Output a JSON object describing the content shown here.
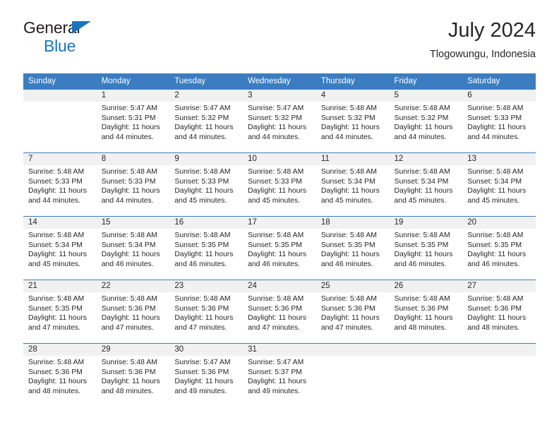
{
  "brand": {
    "line1": "General",
    "line2": "Blue",
    "triangle_color": "#1b74bb"
  },
  "header": {
    "title": "July 2024",
    "location": "Tlogowungu, Indonesia"
  },
  "theme": {
    "header_blue": "#3b7dc0",
    "daynum_background": "#f1f1f1",
    "text": "#262626"
  },
  "weekday_headers": [
    "Sunday",
    "Monday",
    "Tuesday",
    "Wednesday",
    "Thursday",
    "Friday",
    "Saturday"
  ],
  "weeks": [
    [
      {
        "day": "",
        "sunrise": "",
        "sunset": "",
        "daylight_line1": "",
        "daylight_line2": ""
      },
      {
        "day": "1",
        "sunrise": "Sunrise: 5:47 AM",
        "sunset": "Sunset: 5:31 PM",
        "daylight_line1": "Daylight: 11 hours",
        "daylight_line2": "and 44 minutes."
      },
      {
        "day": "2",
        "sunrise": "Sunrise: 5:47 AM",
        "sunset": "Sunset: 5:32 PM",
        "daylight_line1": "Daylight: 11 hours",
        "daylight_line2": "and 44 minutes."
      },
      {
        "day": "3",
        "sunrise": "Sunrise: 5:47 AM",
        "sunset": "Sunset: 5:32 PM",
        "daylight_line1": "Daylight: 11 hours",
        "daylight_line2": "and 44 minutes."
      },
      {
        "day": "4",
        "sunrise": "Sunrise: 5:48 AM",
        "sunset": "Sunset: 5:32 PM",
        "daylight_line1": "Daylight: 11 hours",
        "daylight_line2": "and 44 minutes."
      },
      {
        "day": "5",
        "sunrise": "Sunrise: 5:48 AM",
        "sunset": "Sunset: 5:32 PM",
        "daylight_line1": "Daylight: 11 hours",
        "daylight_line2": "and 44 minutes."
      },
      {
        "day": "6",
        "sunrise": "Sunrise: 5:48 AM",
        "sunset": "Sunset: 5:33 PM",
        "daylight_line1": "Daylight: 11 hours",
        "daylight_line2": "and 44 minutes."
      }
    ],
    [
      {
        "day": "7",
        "sunrise": "Sunrise: 5:48 AM",
        "sunset": "Sunset: 5:33 PM",
        "daylight_line1": "Daylight: 11 hours",
        "daylight_line2": "and 44 minutes."
      },
      {
        "day": "8",
        "sunrise": "Sunrise: 5:48 AM",
        "sunset": "Sunset: 5:33 PM",
        "daylight_line1": "Daylight: 11 hours",
        "daylight_line2": "and 44 minutes."
      },
      {
        "day": "9",
        "sunrise": "Sunrise: 5:48 AM",
        "sunset": "Sunset: 5:33 PM",
        "daylight_line1": "Daylight: 11 hours",
        "daylight_line2": "and 45 minutes."
      },
      {
        "day": "10",
        "sunrise": "Sunrise: 5:48 AM",
        "sunset": "Sunset: 5:33 PM",
        "daylight_line1": "Daylight: 11 hours",
        "daylight_line2": "and 45 minutes."
      },
      {
        "day": "11",
        "sunrise": "Sunrise: 5:48 AM",
        "sunset": "Sunset: 5:34 PM",
        "daylight_line1": "Daylight: 11 hours",
        "daylight_line2": "and 45 minutes."
      },
      {
        "day": "12",
        "sunrise": "Sunrise: 5:48 AM",
        "sunset": "Sunset: 5:34 PM",
        "daylight_line1": "Daylight: 11 hours",
        "daylight_line2": "and 45 minutes."
      },
      {
        "day": "13",
        "sunrise": "Sunrise: 5:48 AM",
        "sunset": "Sunset: 5:34 PM",
        "daylight_line1": "Daylight: 11 hours",
        "daylight_line2": "and 45 minutes."
      }
    ],
    [
      {
        "day": "14",
        "sunrise": "Sunrise: 5:48 AM",
        "sunset": "Sunset: 5:34 PM",
        "daylight_line1": "Daylight: 11 hours",
        "daylight_line2": "and 45 minutes."
      },
      {
        "day": "15",
        "sunrise": "Sunrise: 5:48 AM",
        "sunset": "Sunset: 5:34 PM",
        "daylight_line1": "Daylight: 11 hours",
        "daylight_line2": "and 46 minutes."
      },
      {
        "day": "16",
        "sunrise": "Sunrise: 5:48 AM",
        "sunset": "Sunset: 5:35 PM",
        "daylight_line1": "Daylight: 11 hours",
        "daylight_line2": "and 46 minutes."
      },
      {
        "day": "17",
        "sunrise": "Sunrise: 5:48 AM",
        "sunset": "Sunset: 5:35 PM",
        "daylight_line1": "Daylight: 11 hours",
        "daylight_line2": "and 46 minutes."
      },
      {
        "day": "18",
        "sunrise": "Sunrise: 5:48 AM",
        "sunset": "Sunset: 5:35 PM",
        "daylight_line1": "Daylight: 11 hours",
        "daylight_line2": "and 46 minutes."
      },
      {
        "day": "19",
        "sunrise": "Sunrise: 5:48 AM",
        "sunset": "Sunset: 5:35 PM",
        "daylight_line1": "Daylight: 11 hours",
        "daylight_line2": "and 46 minutes."
      },
      {
        "day": "20",
        "sunrise": "Sunrise: 5:48 AM",
        "sunset": "Sunset: 5:35 PM",
        "daylight_line1": "Daylight: 11 hours",
        "daylight_line2": "and 46 minutes."
      }
    ],
    [
      {
        "day": "21",
        "sunrise": "Sunrise: 5:48 AM",
        "sunset": "Sunset: 5:35 PM",
        "daylight_line1": "Daylight: 11 hours",
        "daylight_line2": "and 47 minutes."
      },
      {
        "day": "22",
        "sunrise": "Sunrise: 5:48 AM",
        "sunset": "Sunset: 5:36 PM",
        "daylight_line1": "Daylight: 11 hours",
        "daylight_line2": "and 47 minutes."
      },
      {
        "day": "23",
        "sunrise": "Sunrise: 5:48 AM",
        "sunset": "Sunset: 5:36 PM",
        "daylight_line1": "Daylight: 11 hours",
        "daylight_line2": "and 47 minutes."
      },
      {
        "day": "24",
        "sunrise": "Sunrise: 5:48 AM",
        "sunset": "Sunset: 5:36 PM",
        "daylight_line1": "Daylight: 11 hours",
        "daylight_line2": "and 47 minutes."
      },
      {
        "day": "25",
        "sunrise": "Sunrise: 5:48 AM",
        "sunset": "Sunset: 5:36 PM",
        "daylight_line1": "Daylight: 11 hours",
        "daylight_line2": "and 47 minutes."
      },
      {
        "day": "26",
        "sunrise": "Sunrise: 5:48 AM",
        "sunset": "Sunset: 5:36 PM",
        "daylight_line1": "Daylight: 11 hours",
        "daylight_line2": "and 48 minutes."
      },
      {
        "day": "27",
        "sunrise": "Sunrise: 5:48 AM",
        "sunset": "Sunset: 5:36 PM",
        "daylight_line1": "Daylight: 11 hours",
        "daylight_line2": "and 48 minutes."
      }
    ],
    [
      {
        "day": "28",
        "sunrise": "Sunrise: 5:48 AM",
        "sunset": "Sunset: 5:36 PM",
        "daylight_line1": "Daylight: 11 hours",
        "daylight_line2": "and 48 minutes."
      },
      {
        "day": "29",
        "sunrise": "Sunrise: 5:48 AM",
        "sunset": "Sunset: 5:36 PM",
        "daylight_line1": "Daylight: 11 hours",
        "daylight_line2": "and 48 minutes."
      },
      {
        "day": "30",
        "sunrise": "Sunrise: 5:47 AM",
        "sunset": "Sunset: 5:36 PM",
        "daylight_line1": "Daylight: 11 hours",
        "daylight_line2": "and 49 minutes."
      },
      {
        "day": "31",
        "sunrise": "Sunrise: 5:47 AM",
        "sunset": "Sunset: 5:37 PM",
        "daylight_line1": "Daylight: 11 hours",
        "daylight_line2": "and 49 minutes."
      },
      {
        "day": "",
        "sunrise": "",
        "sunset": "",
        "daylight_line1": "",
        "daylight_line2": ""
      },
      {
        "day": "",
        "sunrise": "",
        "sunset": "",
        "daylight_line1": "",
        "daylight_line2": ""
      },
      {
        "day": "",
        "sunrise": "",
        "sunset": "",
        "daylight_line1": "",
        "daylight_line2": ""
      }
    ]
  ]
}
